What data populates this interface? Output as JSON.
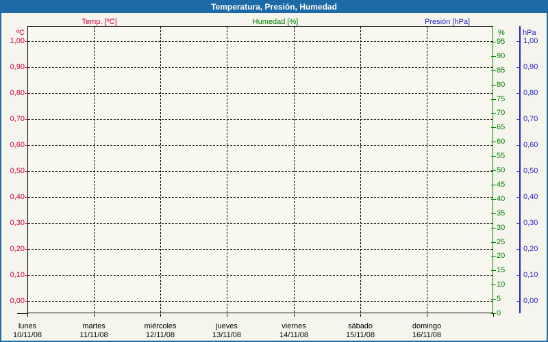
{
  "window": {
    "title": "Temperatura, Presión, Humedad"
  },
  "legend": {
    "temp": "Temp. [ºC]",
    "humidity": "Humedad [%]",
    "pressure": "Presión [hPa]"
  },
  "axes": {
    "temp": {
      "unit": "ºC",
      "ticks": [
        "1,00",
        "0,90",
        "0,80",
        "0,70",
        "0,60",
        "0,50",
        "0,40",
        "0,30",
        "0,20",
        "0,10",
        "0,00"
      ]
    },
    "humidity": {
      "unit": "%",
      "ticks": [
        "95",
        "90",
        "85",
        "80",
        "75",
        "70",
        "65",
        "60",
        "55",
        "50",
        "45",
        "40",
        "35",
        "30",
        "25",
        "20",
        "15",
        "10",
        "5",
        "0"
      ]
    },
    "pressure": {
      "unit": "hPa",
      "ticks": [
        "1,00",
        "0,90",
        "0,80",
        "0,70",
        "0,60",
        "0,50",
        "0,40",
        "0,30",
        "0,20",
        "0,10",
        "0,00"
      ]
    },
    "x": {
      "days": [
        {
          "name": "lunes",
          "date": "10/11/08"
        },
        {
          "name": "martes",
          "date": "11/11/08"
        },
        {
          "name": "miércoles",
          "date": "12/11/08"
        },
        {
          "name": "jueves",
          "date": "13/11/08"
        },
        {
          "name": "viernes",
          "date": "14/11/08"
        },
        {
          "name": "sábado",
          "date": "15/11/08"
        },
        {
          "name": "domingo",
          "date": "16/11/08"
        }
      ]
    }
  },
  "colors": {
    "titlebar": "#1d6aa6",
    "temp": "#cc0033",
    "humidity": "#007d00",
    "pressure": "#2424cc",
    "background": "#f6f5ed",
    "grid": "#000000"
  },
  "chart_data": {
    "type": "line",
    "title": "Temperatura, Presión, Humedad",
    "categories": [
      "10/11/08",
      "11/11/08",
      "12/11/08",
      "13/11/08",
      "14/11/08",
      "15/11/08",
      "16/11/08"
    ],
    "category_day_names": [
      "lunes",
      "martes",
      "miércoles",
      "jueves",
      "viernes",
      "sábado",
      "domingo"
    ],
    "series": [
      {
        "name": "Temp. [ºC]",
        "axis": "left",
        "ylim": [
          0.0,
          1.0
        ],
        "tick_step": 0.1,
        "values": []
      },
      {
        "name": "Humedad [%]",
        "axis": "right-inner",
        "ylim": [
          0,
          100
        ],
        "tick_step": 5,
        "values": []
      },
      {
        "name": "Presión [hPa]",
        "axis": "right-outer",
        "ylim": [
          0.0,
          1.0
        ],
        "tick_step": 0.1,
        "values": []
      }
    ],
    "grid": "dashed",
    "legend_position": "top",
    "note": "Empty plot area — no data points are drawn in the screenshot"
  }
}
